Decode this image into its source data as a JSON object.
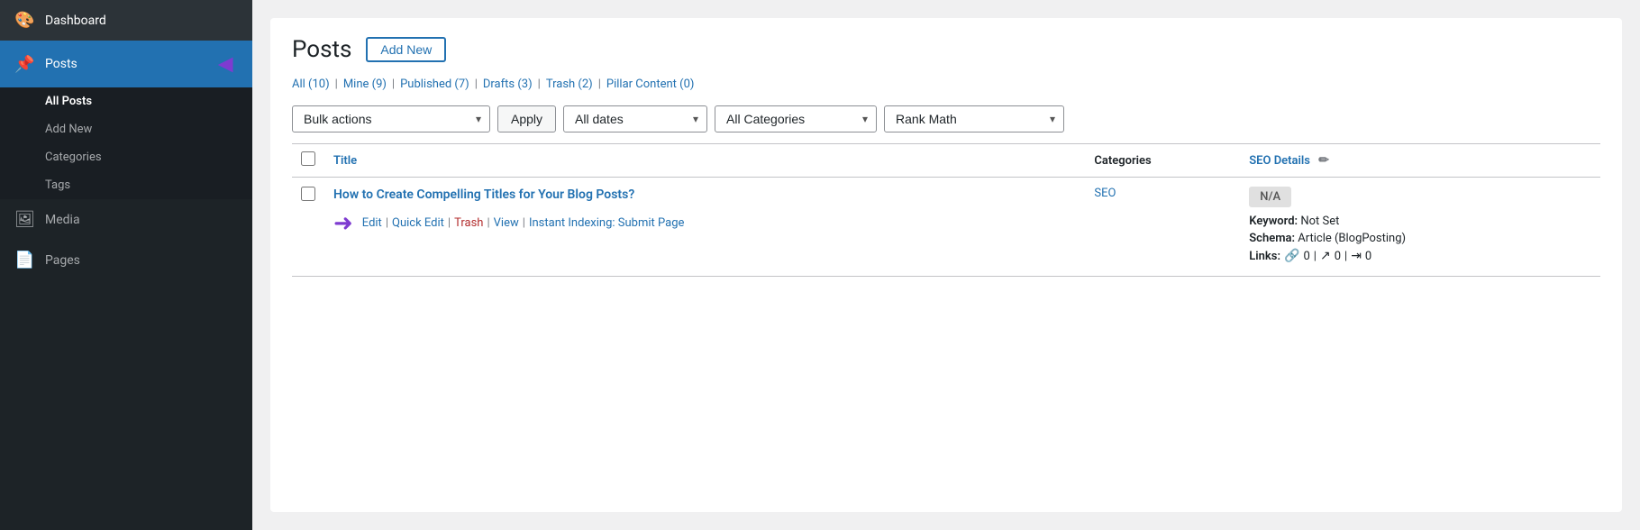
{
  "sidebar": {
    "items": [
      {
        "id": "dashboard",
        "label": "Dashboard",
        "icon": "🎨"
      },
      {
        "id": "posts",
        "label": "Posts",
        "icon": "📌",
        "active": true
      },
      {
        "id": "media",
        "label": "Media",
        "icon": "🖼"
      },
      {
        "id": "pages",
        "label": "Pages",
        "icon": "📄"
      }
    ],
    "submenu": [
      {
        "id": "all-posts",
        "label": "All Posts",
        "active": true
      },
      {
        "id": "add-new",
        "label": "Add New"
      },
      {
        "id": "categories",
        "label": "Categories"
      },
      {
        "id": "tags",
        "label": "Tags"
      }
    ]
  },
  "header": {
    "title": "Posts",
    "add_new_label": "Add New"
  },
  "filter_links": [
    {
      "id": "all",
      "label": "All",
      "count": "(10)"
    },
    {
      "id": "mine",
      "label": "Mine",
      "count": "(9)"
    },
    {
      "id": "published",
      "label": "Published",
      "count": "(7)"
    },
    {
      "id": "drafts",
      "label": "Drafts",
      "count": "(3)"
    },
    {
      "id": "trash",
      "label": "Trash",
      "count": "(2)"
    },
    {
      "id": "pillar",
      "label": "Pillar Content",
      "count": "(0)"
    }
  ],
  "toolbar": {
    "bulk_actions_label": "Bulk actions",
    "apply_label": "Apply",
    "all_dates_label": "All dates",
    "all_categories_label": "All Categories",
    "rank_math_label": "Rank Math"
  },
  "table": {
    "cols": {
      "title": "Title",
      "categories": "Categories",
      "seo": "SEO Details"
    },
    "rows": [
      {
        "id": 1,
        "title": "How to Create Compelling Titles for Your Blog Posts?",
        "category": "SEO",
        "seo_badge": "N/A",
        "keyword": "Not Set",
        "schema": "Article (BlogPosting)",
        "links_internal": "0",
        "links_external": "0",
        "links_affiliate": "0",
        "actions": {
          "edit": "Edit",
          "quick_edit": "Quick Edit",
          "trash": "Trash",
          "view": "View",
          "instant_indexing": "Instant Indexing: Submit Page"
        }
      }
    ]
  },
  "icons": {
    "link": "🔗",
    "external": "↗",
    "affiliate": "⇥",
    "pencil": "✏"
  }
}
